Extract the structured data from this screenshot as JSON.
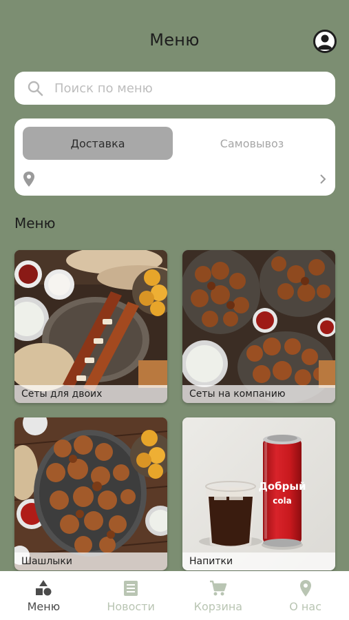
{
  "header": {
    "title": "Меню"
  },
  "search": {
    "placeholder": "Поиск по меню"
  },
  "delivery_mode": {
    "options": [
      "Доставка",
      "Самовывоз"
    ],
    "selected": "Доставка"
  },
  "section": {
    "title": "Меню"
  },
  "categories": [
    {
      "label": "Сеты для двоих"
    },
    {
      "label": "Сеты на компанию"
    },
    {
      "label": "Шашлыки"
    },
    {
      "label": "Напитки"
    }
  ],
  "drink_can": {
    "brand": "Добрый",
    "subtitle": "cola"
  },
  "tabbar": {
    "items": [
      {
        "label": "Меню",
        "icon": "shapes-icon",
        "active": true
      },
      {
        "label": "Новости",
        "icon": "news-icon",
        "active": false
      },
      {
        "label": "Корзина",
        "icon": "cart-icon",
        "active": false
      },
      {
        "label": "О нас",
        "icon": "location-pin-icon",
        "active": false
      }
    ]
  },
  "colors": {
    "background": "#7c8e72",
    "active_tab": "#a8a8a8",
    "inactive_nav": "#b9c5b3",
    "can_red": "#c8191e"
  }
}
